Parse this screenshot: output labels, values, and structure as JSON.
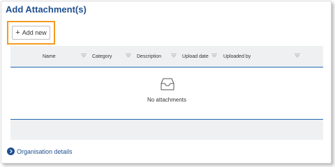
{
  "section": {
    "title": "Add Attachment(s)"
  },
  "toolbar": {
    "add_label": "Add new"
  },
  "table": {
    "columns": [
      {
        "label": "Name"
      },
      {
        "label": "Category"
      },
      {
        "label": "Description"
      },
      {
        "label": "Upload date"
      },
      {
        "label": "Uploaded by"
      }
    ],
    "empty_text": "No attachments"
  },
  "footer": {
    "org_details_label": "Organisation details"
  },
  "colors": {
    "accent": "#1f4f8f",
    "highlight": "#f39c1f",
    "divider": "#1f66b0"
  },
  "icons": [
    "plus-icon",
    "filter-icon",
    "empty-tray-icon",
    "chevron-right-icon"
  ]
}
